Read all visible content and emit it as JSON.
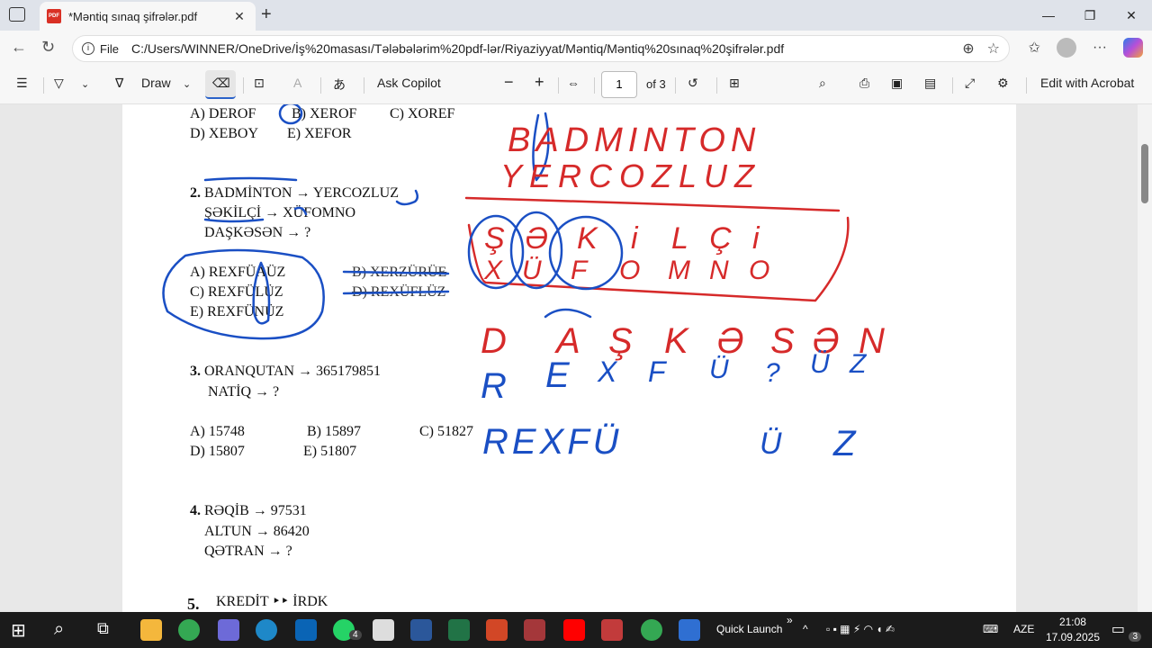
{
  "browser": {
    "tab_title": "*Məntiq sınaq şifrələr.pdf",
    "tab_pdf_badge": "PDF",
    "new_tab": "+",
    "close_tab": "✕",
    "file_label": "File",
    "url": "C:/Users/WINNER/OneDrive/İş%20masası/Tələbələrim%20pdf-lər/Riyaziyyat/Məntiq/Məntiq%20sınaq%20şifrələr.pdf"
  },
  "pdf_toolbar": {
    "draw_label": "Draw",
    "ask_copilot": "Ask Copilot",
    "zoom_out": "−",
    "zoom_in": "+",
    "page_number": "1",
    "page_total": "of 3",
    "edit_acrobat": "Edit with Acrobat"
  },
  "document": {
    "q1_options_row1": [
      "A) DEROF",
      "B) XEROF",
      "C) XOREF"
    ],
    "q1_options_row2": [
      "D) XEBOY",
      "E) XEFOR"
    ],
    "q2_number": "2.",
    "q2_line1": "BADMİNTON → YERCOZLUZ",
    "q2_line2": "ŞƏKİLÇİ → XÜFOMNO",
    "q2_line3": "DAŞKƏSƏN → ?",
    "q2_opt_a": "A) REXFÜAÜZ",
    "q2_opt_b": "B) XERZÜRÜE",
    "q2_opt_c": "C) REXFÜLÜZ",
    "q2_opt_d": "D) REXÜFLÜZ",
    "q2_opt_e": "E) REXFÜNÜZ",
    "q3_number": "3.",
    "q3_line1": "ORANQUTAN → 365179851",
    "q3_line2": "NATİQ → ?",
    "q3_opt_a": "A) 15748",
    "q3_opt_b": "B) 15897",
    "q3_opt_c": "C) 51827",
    "q3_opt_d": "D) 15807",
    "q3_opt_e": "E) 51807",
    "q4_number": "4.",
    "q4_line1": "RƏQİB → 97531",
    "q4_line2": "ALTUN → 86420",
    "q4_line3": "QƏTRAN → ?",
    "q5_number": "5.",
    "q5_line1": "KREDİT ‣‣ İRDK"
  },
  "annotations": {
    "red_word1": "BADMINTON",
    "red_word2": "YERCOZLUZ",
    "red_row1": [
      "Ş",
      "Ə",
      "K",
      "i",
      "L",
      "Ç",
      "i"
    ],
    "blue_row1": [
      "X",
      "Ü",
      "F",
      "O",
      "M",
      "N",
      "O"
    ],
    "red_row2": [
      "D",
      "A",
      "Ş",
      "K",
      "Ə",
      "S",
      "Ə",
      "N"
    ],
    "blue_row2": [
      "R",
      "E",
      "X",
      "F",
      "Ü",
      "?",
      "Ü",
      "Z"
    ],
    "blue_answer_part1": "REXFÜ",
    "blue_answer_part2": "Ü",
    "blue_answer_part3": "Z"
  },
  "taskbar": {
    "quick_launch": "Quick Launch",
    "language": "AZE",
    "time": "21:08",
    "date": "17.09.2025",
    "whatsapp_badge": "4",
    "notif_badge": "3"
  },
  "colors": {
    "ink_red": "#d62a2a",
    "ink_blue": "#1a4fc4",
    "accent": "#2a62c9"
  }
}
